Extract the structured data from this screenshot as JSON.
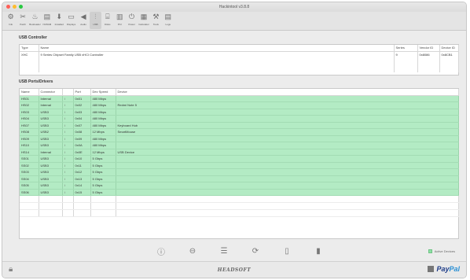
{
  "window": {
    "title": "Hackintool v3.8.8"
  },
  "toolbar": {
    "items": [
      {
        "label": "Info",
        "icon": "⚙"
      },
      {
        "label": "Patch",
        "icon": "✂"
      },
      {
        "label": "Bootloader",
        "icon": "♨"
      },
      {
        "label": "NVRAM",
        "icon": "▤"
      },
      {
        "label": "Installed",
        "icon": "⬇"
      },
      {
        "label": "Displays",
        "icon": "▭"
      },
      {
        "label": "Audio",
        "icon": "◀"
      },
      {
        "label": "USB",
        "icon": "⫶"
      },
      {
        "label": "Disks",
        "icon": "⌸"
      },
      {
        "label": "PCI",
        "icon": "▥"
      },
      {
        "label": "Power",
        "icon": "⏻"
      },
      {
        "label": "Calculator",
        "icon": "▦"
      },
      {
        "label": "Tools",
        "icon": "⚒"
      },
      {
        "label": "Logs",
        "icon": "▤"
      }
    ],
    "active_index": 7
  },
  "controllers": {
    "title": "USB Controller",
    "columns": [
      "Type",
      "Name",
      "Series",
      "Vendor ID",
      "Device ID"
    ],
    "rows": [
      [
        "XHC",
        "9 Series Chipset Family USB xHCI Controller",
        "9",
        "0x8086",
        "0x8CB1"
      ]
    ]
  },
  "ports": {
    "title": "USB Ports/Drivers",
    "columns": [
      "Name",
      "Connector",
      "",
      "Port",
      "Dev Speed",
      "Device"
    ],
    "rows": [
      [
        "HS01",
        "Internal",
        "↕",
        "0x01",
        "480 Mbps",
        ""
      ],
      [
        "HS02",
        "Internal",
        "↕",
        "0x02",
        "480 Mbps",
        "Redmi Note 5"
      ],
      [
        "HS03",
        "USB3",
        "↕",
        "0x03",
        "480 Mbps",
        ""
      ],
      [
        "HS04",
        "USB3",
        "↕",
        "0x04",
        "480 Mbps",
        ""
      ],
      [
        "HS07",
        "USB3",
        "↕",
        "0x07",
        "480 Mbps",
        "Keyboard Hub"
      ],
      [
        "HS08",
        "USB2",
        "↕",
        "0x08",
        "12 Mbps",
        "SmartMouse"
      ],
      [
        "HS09",
        "USB3",
        "↕",
        "0x09",
        "480 Mbps",
        ""
      ],
      [
        "HS10",
        "USB3",
        "↕",
        "0x0A",
        "480 Mbps",
        ""
      ],
      [
        "HS14",
        "Internal",
        "↕",
        "0x0E",
        "12 Mbps",
        "USB Device"
      ],
      [
        "SS01",
        "USB3",
        "↕",
        "0x10",
        "5 Gbps",
        ""
      ],
      [
        "SS02",
        "USB3",
        "↕",
        "0x11",
        "5 Gbps",
        ""
      ],
      [
        "SS03",
        "USB3",
        "↕",
        "0x12",
        "5 Gbps",
        ""
      ],
      [
        "SS04",
        "USB3",
        "↕",
        "0x13",
        "5 Gbps",
        ""
      ],
      [
        "SS05",
        "USB3",
        "↕",
        "0x14",
        "5 Gbps",
        ""
      ],
      [
        "SS06",
        "USB3",
        "↕",
        "0x15",
        "5 Gbps",
        ""
      ]
    ]
  },
  "legend": {
    "label": "Active Devices",
    "color": "#8fe0a6"
  },
  "footer": {
    "brand": "HEADSOFT",
    "donate_a": "Pay",
    "donate_b": "Pal"
  }
}
